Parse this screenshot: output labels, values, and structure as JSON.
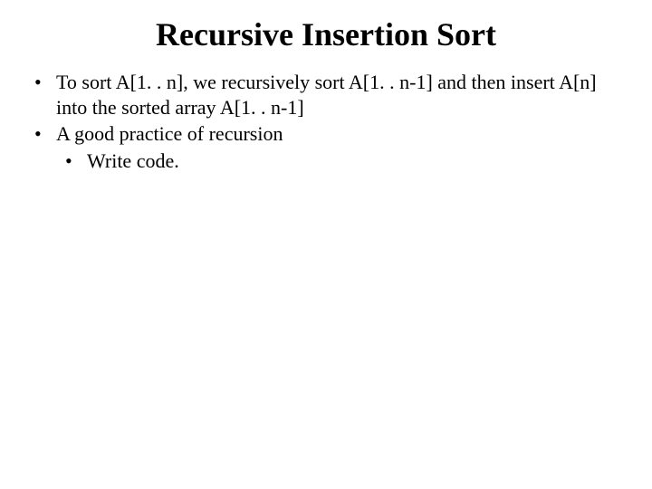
{
  "slide": {
    "title": "Recursive Insertion Sort",
    "bullets": [
      {
        "text": "To sort A[1. . n], we recursively sort A[1. . n-1] and then insert A[n] into the sorted array A[1. . n-1]"
      },
      {
        "text": "A good practice of recursion",
        "children": [
          {
            "text": "Write code."
          }
        ]
      }
    ]
  }
}
